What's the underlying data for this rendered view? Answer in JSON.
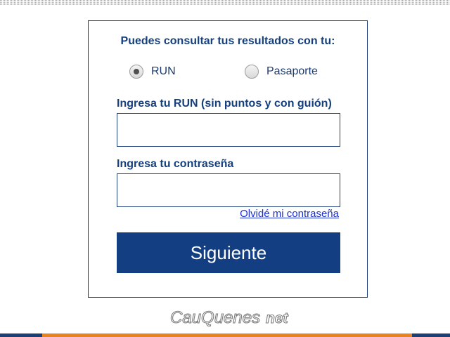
{
  "form": {
    "intro": "Puedes consultar tus resultados con tu:",
    "radio_options": [
      {
        "label": "RUN",
        "checked": true
      },
      {
        "label": "Pasaporte",
        "checked": false
      }
    ],
    "run_label": "Ingresa tu RUN (sin puntos y con guión)",
    "run_value": "",
    "password_label": "Ingresa tu contraseña",
    "password_value": "",
    "forgot_link": "Olvidé mi contraseña",
    "submit_label": "Siguiente"
  },
  "footer": {
    "logo_text": "CauQuenes",
    "logo_suffix": "net"
  },
  "colors": {
    "primary": "#133f82",
    "accent": "#e8821e",
    "link": "#1a2fd6"
  }
}
